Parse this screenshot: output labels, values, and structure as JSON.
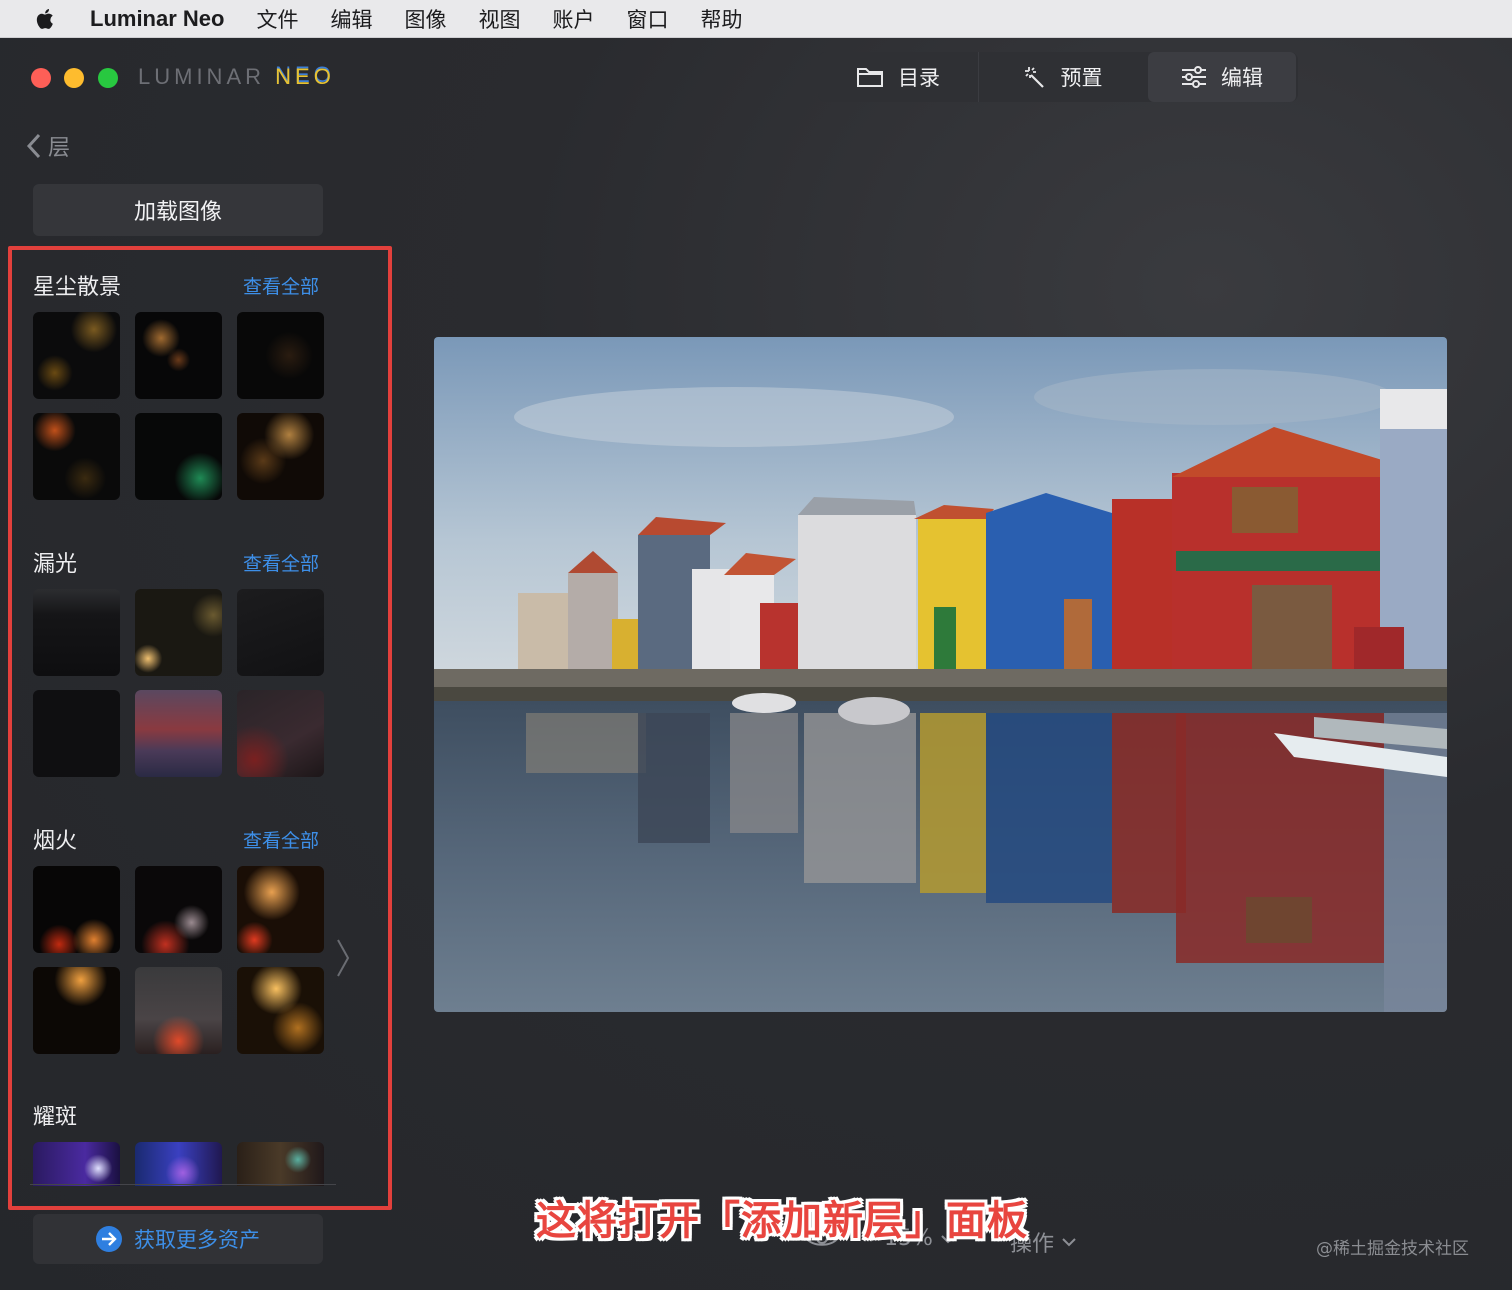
{
  "menubar": {
    "app_name": "Luminar Neo",
    "items": [
      "文件",
      "编辑",
      "图像",
      "视图",
      "账户",
      "窗口",
      "帮助"
    ]
  },
  "logo": {
    "part1": "LUMINAR",
    "part2": "NEO"
  },
  "tabs": {
    "catalog": "目录",
    "presets": "预置",
    "edit": "编辑"
  },
  "back_label": "层",
  "load_image": "加载图像",
  "sections": [
    {
      "title": "星尘散景",
      "link": "查看全部"
    },
    {
      "title": "漏光",
      "link": "查看全部"
    },
    {
      "title": "烟火",
      "link": "查看全部"
    },
    {
      "title": "耀斑"
    }
  ],
  "more_assets": "获取更多资产",
  "bottom": {
    "zoom": "15%",
    "actions": "操作"
  },
  "caption": "这将打开「添加新层」面板",
  "watermark": "@稀土掘金技术社区",
  "colors": {
    "accent_blue": "#3d8fe8",
    "highlight_red": "#e2403c",
    "caption_red": "#e8453f"
  }
}
